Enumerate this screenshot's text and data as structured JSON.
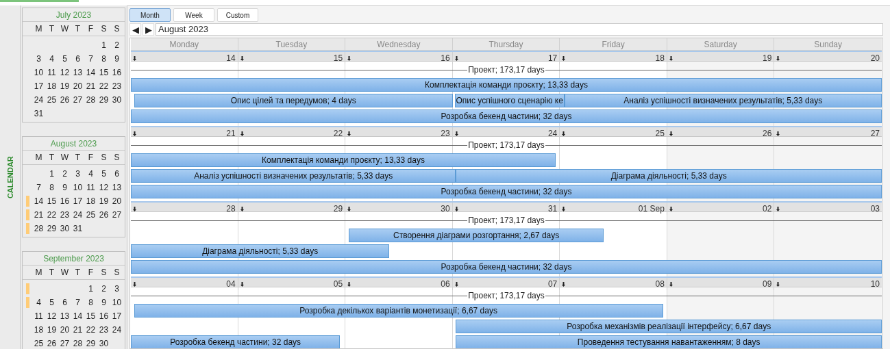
{
  "side_tab": "CALENDAR",
  "mini_calendars": [
    {
      "title": "July 2023",
      "weekdays": [
        "M",
        "T",
        "W",
        "T",
        "F",
        "S",
        "S"
      ],
      "weeks": [
        {
          "days": [
            "1",
            "2"
          ],
          "marked": false
        },
        {
          "days": [
            "3",
            "4",
            "5",
            "6",
            "7",
            "8",
            "9"
          ],
          "marked": false
        },
        {
          "days": [
            "10",
            "11",
            "12",
            "13",
            "14",
            "15",
            "16"
          ],
          "marked": false
        },
        {
          "days": [
            "17",
            "18",
            "19",
            "20",
            "21",
            "22",
            "23"
          ],
          "marked": false
        },
        {
          "days": [
            "24",
            "25",
            "26",
            "27",
            "28",
            "29",
            "30"
          ],
          "marked": false
        },
        {
          "days": [
            "31"
          ],
          "marked": false
        }
      ]
    },
    {
      "title": "August 2023",
      "weekdays": [
        "M",
        "T",
        "W",
        "T",
        "F",
        "S",
        "S"
      ],
      "weeks": [
        {
          "days": [
            "1",
            "2",
            "3",
            "4",
            "5",
            "6"
          ],
          "marked": false
        },
        {
          "days": [
            "7",
            "8",
            "9",
            "10",
            "11",
            "12",
            "13"
          ],
          "marked": false
        },
        {
          "days": [
            "14",
            "15",
            "16",
            "17",
            "18",
            "19",
            "20"
          ],
          "marked": true
        },
        {
          "days": [
            "21",
            "22",
            "23",
            "24",
            "25",
            "26",
            "27"
          ],
          "marked": true
        },
        {
          "days": [
            "28",
            "29",
            "30",
            "31"
          ],
          "marked": true
        }
      ]
    },
    {
      "title": "September 2023",
      "weekdays": [
        "M",
        "T",
        "W",
        "T",
        "F",
        "S",
        "S"
      ],
      "weeks": [
        {
          "days": [
            "1",
            "2",
            "3"
          ],
          "marked": true
        },
        {
          "days": [
            "4",
            "5",
            "6",
            "7",
            "8",
            "9",
            "10"
          ],
          "marked": true
        },
        {
          "days": [
            "11",
            "12",
            "13",
            "14",
            "15",
            "16",
            "17"
          ],
          "marked": false
        },
        {
          "days": [
            "18",
            "19",
            "20",
            "21",
            "22",
            "23",
            "24"
          ],
          "marked": false
        },
        {
          "days": [
            "25",
            "26",
            "27",
            "28",
            "29",
            "30"
          ],
          "marked": false
        }
      ]
    }
  ],
  "view_tabs": [
    {
      "label": "Month",
      "selected": true
    },
    {
      "label": "Week",
      "selected": false
    },
    {
      "label": "Custom",
      "selected": false
    }
  ],
  "nav": {
    "prev": "◀",
    "next": "▶",
    "period": "August 2023"
  },
  "day_names": [
    "Monday",
    "Tuesday",
    "Wednesday",
    "Thursday",
    "Friday",
    "Saturday",
    "Sunday"
  ],
  "weeks": [
    {
      "dates": [
        "14",
        "15",
        "16",
        "17",
        "18",
        "19",
        "20"
      ],
      "summary": "Проект; 173,17 days",
      "lanes": [
        {
          "tasks": [
            {
              "label": "Комплектація команди проєкту; 13,33 days"
            }
          ]
        },
        {
          "tasks": [
            {
              "label": "Опис цілей та передумов; 4 days"
            },
            {
              "label": "Опис успішного сценарію ке"
            },
            {
              "label": "Аналіз успішності визначених результатів; 5,33 days"
            }
          ]
        },
        {
          "tasks": [
            {
              "label": "Розробка бекенд частини; 32 days"
            }
          ]
        }
      ]
    },
    {
      "dates": [
        "21",
        "22",
        "23",
        "24",
        "25",
        "26",
        "27"
      ],
      "summary": "Проект; 173,17 days",
      "lanes": [
        {
          "tasks": [
            {
              "label": "Комплектація команди проєкту; 13,33 days"
            }
          ]
        },
        {
          "tasks": [
            {
              "label": "Аналіз успішності визначених результатів; 5,33 days"
            },
            {
              "label": "Діаграма діяльності; 5,33 days"
            }
          ]
        },
        {
          "tasks": [
            {
              "label": "Розробка бекенд частини; 32 days"
            }
          ]
        }
      ]
    },
    {
      "dates": [
        "28",
        "29",
        "30",
        "31",
        "01 Sep",
        "02",
        "03"
      ],
      "summary": "Проект; 173,17 days",
      "lanes": [
        {
          "tasks": [
            {
              "label": "Створення діаграми розгортання; 2,67 days"
            }
          ]
        },
        {
          "tasks": [
            {
              "label": "Діаграма діяльності; 5,33 days"
            }
          ]
        },
        {
          "tasks": [
            {
              "label": "Розробка бекенд частини; 32 days"
            }
          ]
        }
      ]
    },
    {
      "dates": [
        "04",
        "05",
        "06",
        "07",
        "08",
        "09",
        "10"
      ],
      "summary": "Проект; 173,17 days",
      "lanes": [
        {
          "tasks": [
            {
              "label": "Розробка декількох варіантів монетизації; 6,67 days"
            }
          ]
        },
        {
          "tasks": [
            {
              "label": "Розробка механізмів реалізації інтерфейсу; 6,67 days"
            }
          ]
        },
        {
          "tasks": [
            {
              "label": "Розробка бекенд частини; 32 days"
            },
            {
              "label": "Проведення тестування навантаженням; 8 days"
            }
          ]
        }
      ]
    }
  ]
}
